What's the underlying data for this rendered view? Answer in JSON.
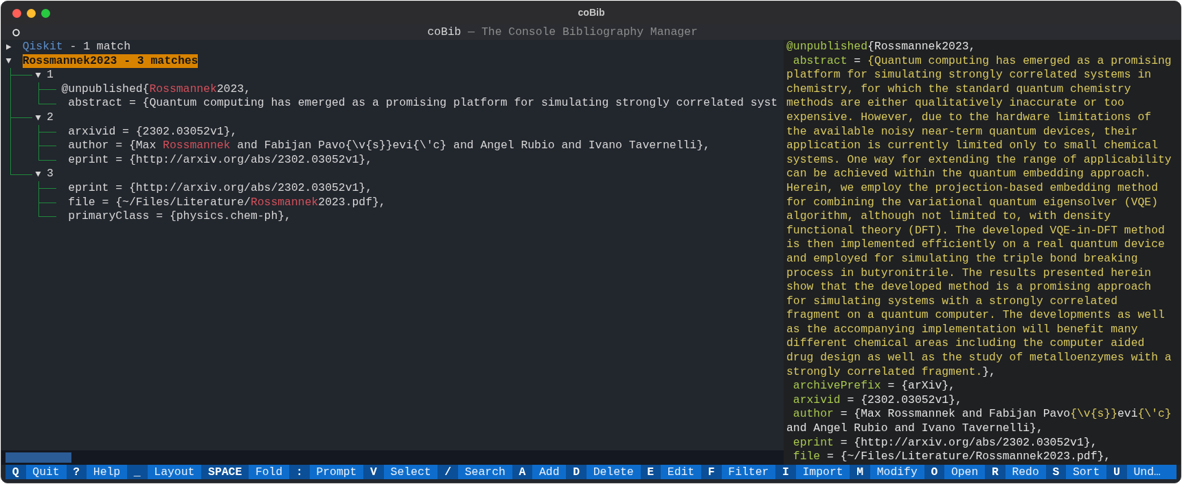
{
  "window": {
    "title": "coBib"
  },
  "header": {
    "title": "coBib",
    "subtitle": "— The Console Bibliography Manager"
  },
  "tree": [
    {
      "label": "Qiskit",
      "suffix": "- 1 match",
      "expanded": false,
      "selected": false
    },
    {
      "label": "Rossmannek2023",
      "suffix": "- 3 matches",
      "expanded": true,
      "selected": true,
      "children": [
        {
          "label": "1",
          "expanded": true,
          "lines": [
            {
              "indent": false,
              "parts": [
                {
                  "text": "@unpublished{",
                  "match": false
                },
                {
                  "text": "Rossmannek",
                  "match": true
                },
                {
                  "text": "2023,",
                  "match": false
                }
              ]
            },
            {
              "indent": true,
              "parts": [
                {
                  "text": "abstract = {Quantum computing has emerged as a promising platform for simulating strongly correlated syst",
                  "match": false
                }
              ]
            }
          ]
        },
        {
          "label": "2",
          "expanded": true,
          "lines": [
            {
              "indent": true,
              "parts": [
                {
                  "text": "arxivid = {2302.03052v1},",
                  "match": false
                }
              ]
            },
            {
              "indent": true,
              "parts": [
                {
                  "text": "author = {Max ",
                  "match": false
                },
                {
                  "text": "Rossmannek",
                  "match": true
                },
                {
                  "text": " and Fabijan Pavo{\\v{s}}evi{\\'c} and Angel Rubio and Ivano Tavernelli},",
                  "match": false
                }
              ]
            },
            {
              "indent": true,
              "parts": [
                {
                  "text": "eprint = {http://arxiv.org/abs/2302.03052v1},",
                  "match": false
                }
              ]
            }
          ]
        },
        {
          "label": "3",
          "expanded": true,
          "lines": [
            {
              "indent": true,
              "parts": [
                {
                  "text": "eprint = {http://arxiv.org/abs/2302.03052v1},",
                  "match": false
                }
              ]
            },
            {
              "indent": true,
              "parts": [
                {
                  "text": "file = {~/Files/Literature/",
                  "match": false
                },
                {
                  "text": "Rossmannek",
                  "match": true
                },
                {
                  "text": "2023.pdf},",
                  "match": false
                }
              ]
            },
            {
              "indent": true,
              "parts": [
                {
                  "text": "primaryClass = {physics.chem-ph},",
                  "match": false
                }
              ]
            }
          ]
        }
      ]
    }
  ],
  "preview": {
    "lines": [
      {
        "indent": false,
        "parts": [
          {
            "kind": "type",
            "text": "@unpublished"
          },
          {
            "kind": "plain",
            "text": "{Rossmannek2023,"
          }
        ]
      },
      {
        "indent": true,
        "parts": [
          {
            "kind": "key",
            "text": "abstract"
          },
          {
            "kind": "plain",
            "text": " = "
          },
          {
            "kind": "string",
            "text": "{Quantum computing has emerged as a promising"
          }
        ]
      },
      {
        "indent": false,
        "parts": [
          {
            "kind": "string",
            "text": "platform for simulating strongly correlated systems in"
          }
        ]
      },
      {
        "indent": false,
        "parts": [
          {
            "kind": "string",
            "text": "chemistry, for which the standard quantum chemistry"
          }
        ]
      },
      {
        "indent": false,
        "parts": [
          {
            "kind": "string",
            "text": "methods are either qualitatively inaccurate or too"
          }
        ]
      },
      {
        "indent": false,
        "parts": [
          {
            "kind": "string",
            "text": "expensive. However, due to the hardware limitations of"
          }
        ]
      },
      {
        "indent": false,
        "parts": [
          {
            "kind": "string",
            "text": "the available noisy near-term quantum devices, their"
          }
        ]
      },
      {
        "indent": false,
        "parts": [
          {
            "kind": "string",
            "text": "application is currently limited only to small chemical"
          }
        ]
      },
      {
        "indent": false,
        "parts": [
          {
            "kind": "string",
            "text": "systems. One way for extending the range of applicability"
          }
        ]
      },
      {
        "indent": false,
        "parts": [
          {
            "kind": "string",
            "text": "can be achieved within the quantum embedding approach."
          }
        ]
      },
      {
        "indent": false,
        "parts": [
          {
            "kind": "string",
            "text": "Herein, we employ the projection-based embedding method"
          }
        ]
      },
      {
        "indent": false,
        "parts": [
          {
            "kind": "string",
            "text": "for combining the variational quantum eigensolver (VQE)"
          }
        ]
      },
      {
        "indent": false,
        "parts": [
          {
            "kind": "string",
            "text": "algorithm, although not limited to, with density"
          }
        ]
      },
      {
        "indent": false,
        "parts": [
          {
            "kind": "string",
            "text": "functional theory (DFT). The developed VQE-in-DFT method"
          }
        ]
      },
      {
        "indent": false,
        "parts": [
          {
            "kind": "string",
            "text": "is then implemented efficiently on a real quantum device"
          }
        ]
      },
      {
        "indent": false,
        "parts": [
          {
            "kind": "string",
            "text": "and employed for simulating the triple bond breaking"
          }
        ]
      },
      {
        "indent": false,
        "parts": [
          {
            "kind": "string",
            "text": "process in butyronitrile. The results presented herein"
          }
        ]
      },
      {
        "indent": false,
        "parts": [
          {
            "kind": "string",
            "text": "show that the developed method is a promising approach"
          }
        ]
      },
      {
        "indent": false,
        "parts": [
          {
            "kind": "string",
            "text": "for simulating systems with a strongly correlated"
          }
        ]
      },
      {
        "indent": false,
        "parts": [
          {
            "kind": "string",
            "text": "fragment on a quantum computer. The developments as well"
          }
        ]
      },
      {
        "indent": false,
        "parts": [
          {
            "kind": "string",
            "text": "as the accompanying implementation will benefit many"
          }
        ]
      },
      {
        "indent": false,
        "parts": [
          {
            "kind": "string",
            "text": "different chemical areas including the computer aided"
          }
        ]
      },
      {
        "indent": false,
        "parts": [
          {
            "kind": "string",
            "text": "drug design as well as the study of metalloenzymes with a"
          }
        ]
      },
      {
        "indent": false,
        "parts": [
          {
            "kind": "string",
            "text": "strongly correlated fragment."
          },
          {
            "kind": "plain",
            "text": "},"
          }
        ]
      },
      {
        "indent": true,
        "parts": [
          {
            "kind": "key",
            "text": "archivePrefix"
          },
          {
            "kind": "plain",
            "text": " = {arXiv},"
          }
        ]
      },
      {
        "indent": true,
        "parts": [
          {
            "kind": "key",
            "text": "arxivid"
          },
          {
            "kind": "plain",
            "text": " = {2302.03052v1},"
          }
        ]
      },
      {
        "indent": true,
        "parts": [
          {
            "kind": "key",
            "text": "author"
          },
          {
            "kind": "plain",
            "text": " = {Max Rossmannek and Fabijan Pavo"
          },
          {
            "kind": "string",
            "text": "{\\v{s}}"
          },
          {
            "kind": "plain",
            "text": "evi"
          },
          {
            "kind": "string",
            "text": "{\\'c}"
          }
        ]
      },
      {
        "indent": false,
        "parts": [
          {
            "kind": "plain",
            "text": "and Angel Rubio and Ivano Tavernelli},"
          }
        ]
      },
      {
        "indent": true,
        "parts": [
          {
            "kind": "key",
            "text": "eprint"
          },
          {
            "kind": "plain",
            "text": " = {http://arxiv.org/abs/2302.03052v1},"
          }
        ]
      },
      {
        "indent": true,
        "parts": [
          {
            "kind": "key",
            "text": "file"
          },
          {
            "kind": "plain",
            "text": " = {~/Files/Literature/Rossmannek2023.pdf},"
          }
        ]
      }
    ]
  },
  "keybar": [
    {
      "key": "Q",
      "label": "Quit"
    },
    {
      "key": "?",
      "label": "Help"
    },
    {
      "key": "_",
      "label": "Layout"
    },
    {
      "key": "SPACE",
      "label": "Fold"
    },
    {
      "key": ":",
      "label": "Prompt"
    },
    {
      "key": "V",
      "label": "Select"
    },
    {
      "key": "/",
      "label": "Search"
    },
    {
      "key": "A",
      "label": "Add"
    },
    {
      "key": "D",
      "label": "Delete"
    },
    {
      "key": "E",
      "label": "Edit"
    },
    {
      "key": "F",
      "label": "Filter"
    },
    {
      "key": "I",
      "label": "Import"
    },
    {
      "key": "M",
      "label": "Modify"
    },
    {
      "key": "O",
      "label": "Open"
    },
    {
      "key": "R",
      "label": "Redo"
    },
    {
      "key": "S",
      "label": "Sort"
    },
    {
      "key": "U",
      "label": "Und…"
    }
  ]
}
